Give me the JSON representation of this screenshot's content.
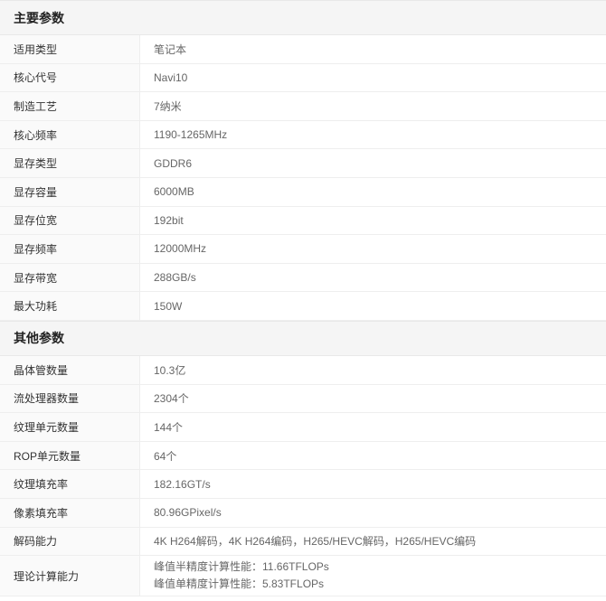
{
  "main_section": {
    "title": "主要参数",
    "rows": [
      {
        "label": "适用类型",
        "value": "笔记本"
      },
      {
        "label": "核心代号",
        "value": "Navi10"
      },
      {
        "label": "制造工艺",
        "value": "7纳米"
      },
      {
        "label": "核心频率",
        "value": "1190-1265MHz"
      },
      {
        "label": "显存类型",
        "value": "GDDR6"
      },
      {
        "label": "显存容量",
        "value": "6000MB"
      },
      {
        "label": "显存位宽",
        "value": "192bit"
      },
      {
        "label": "显存频率",
        "value": "12000MHz"
      },
      {
        "label": "显存带宽",
        "value": "288GB/s"
      },
      {
        "label": "最大功耗",
        "value": "150W"
      }
    ]
  },
  "other_section": {
    "title": "其他参数",
    "rows": [
      {
        "label": "晶体管数量",
        "value": "10.3亿"
      },
      {
        "label": "流处理器数量",
        "value": "2304个"
      },
      {
        "label": "纹理单元数量",
        "value": "144个"
      },
      {
        "label": "ROP单元数量",
        "value": "64个"
      },
      {
        "label": "纹理填充率",
        "value": "182.16GT/s"
      },
      {
        "label": "像素填充率",
        "value": "80.96GPixel/s"
      },
      {
        "label": "解码能力",
        "value": "4K H264解码，4K H264编码，H265/HEVC解码，H265/HEVC编码"
      }
    ],
    "compute_row": {
      "label": "理论计算能力",
      "lines": [
        "峰值半精度计算性能：11.66TFLOPs",
        "峰值单精度计算性能：5.83TFLOPs"
      ]
    }
  }
}
